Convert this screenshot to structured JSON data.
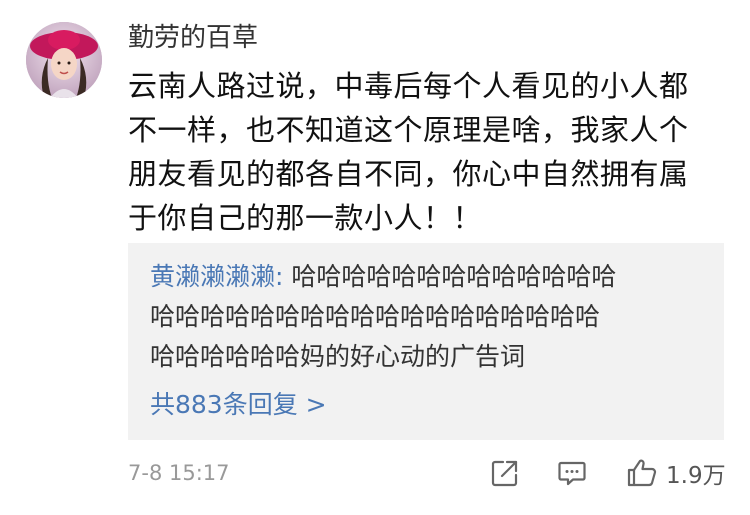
{
  "comment": {
    "username": "勤劳的百草",
    "content_lines": [
      "云南人路过说，中毒后每个人看见的小人都",
      "不一样，也不知道这个原理是啥，我家人个",
      "朋友看见的都各自不同，你心中自然拥有属",
      "于你自己的那一款小人！！"
    ],
    "timestamp": "7-8 15:17",
    "like_count": "1.9万"
  },
  "reply": {
    "author": "黄濑濑濑濑",
    "separator": ":",
    "line1_text": " 哈哈哈哈哈哈哈哈哈哈哈哈哈",
    "line2": "哈哈哈哈哈哈哈哈哈哈哈哈哈哈哈哈哈哈",
    "line3": "哈哈哈哈哈哈妈的好心动的广告词",
    "more_label": "共883条回复 >"
  },
  "icons": {
    "avatar": "avatar",
    "share": "share-icon",
    "comment": "comment-icon",
    "like": "thumbs-up-icon"
  },
  "colors": {
    "link_blue": "#4a78b5",
    "reply_bg": "#f2f2f2",
    "meta_gray": "#999999"
  }
}
